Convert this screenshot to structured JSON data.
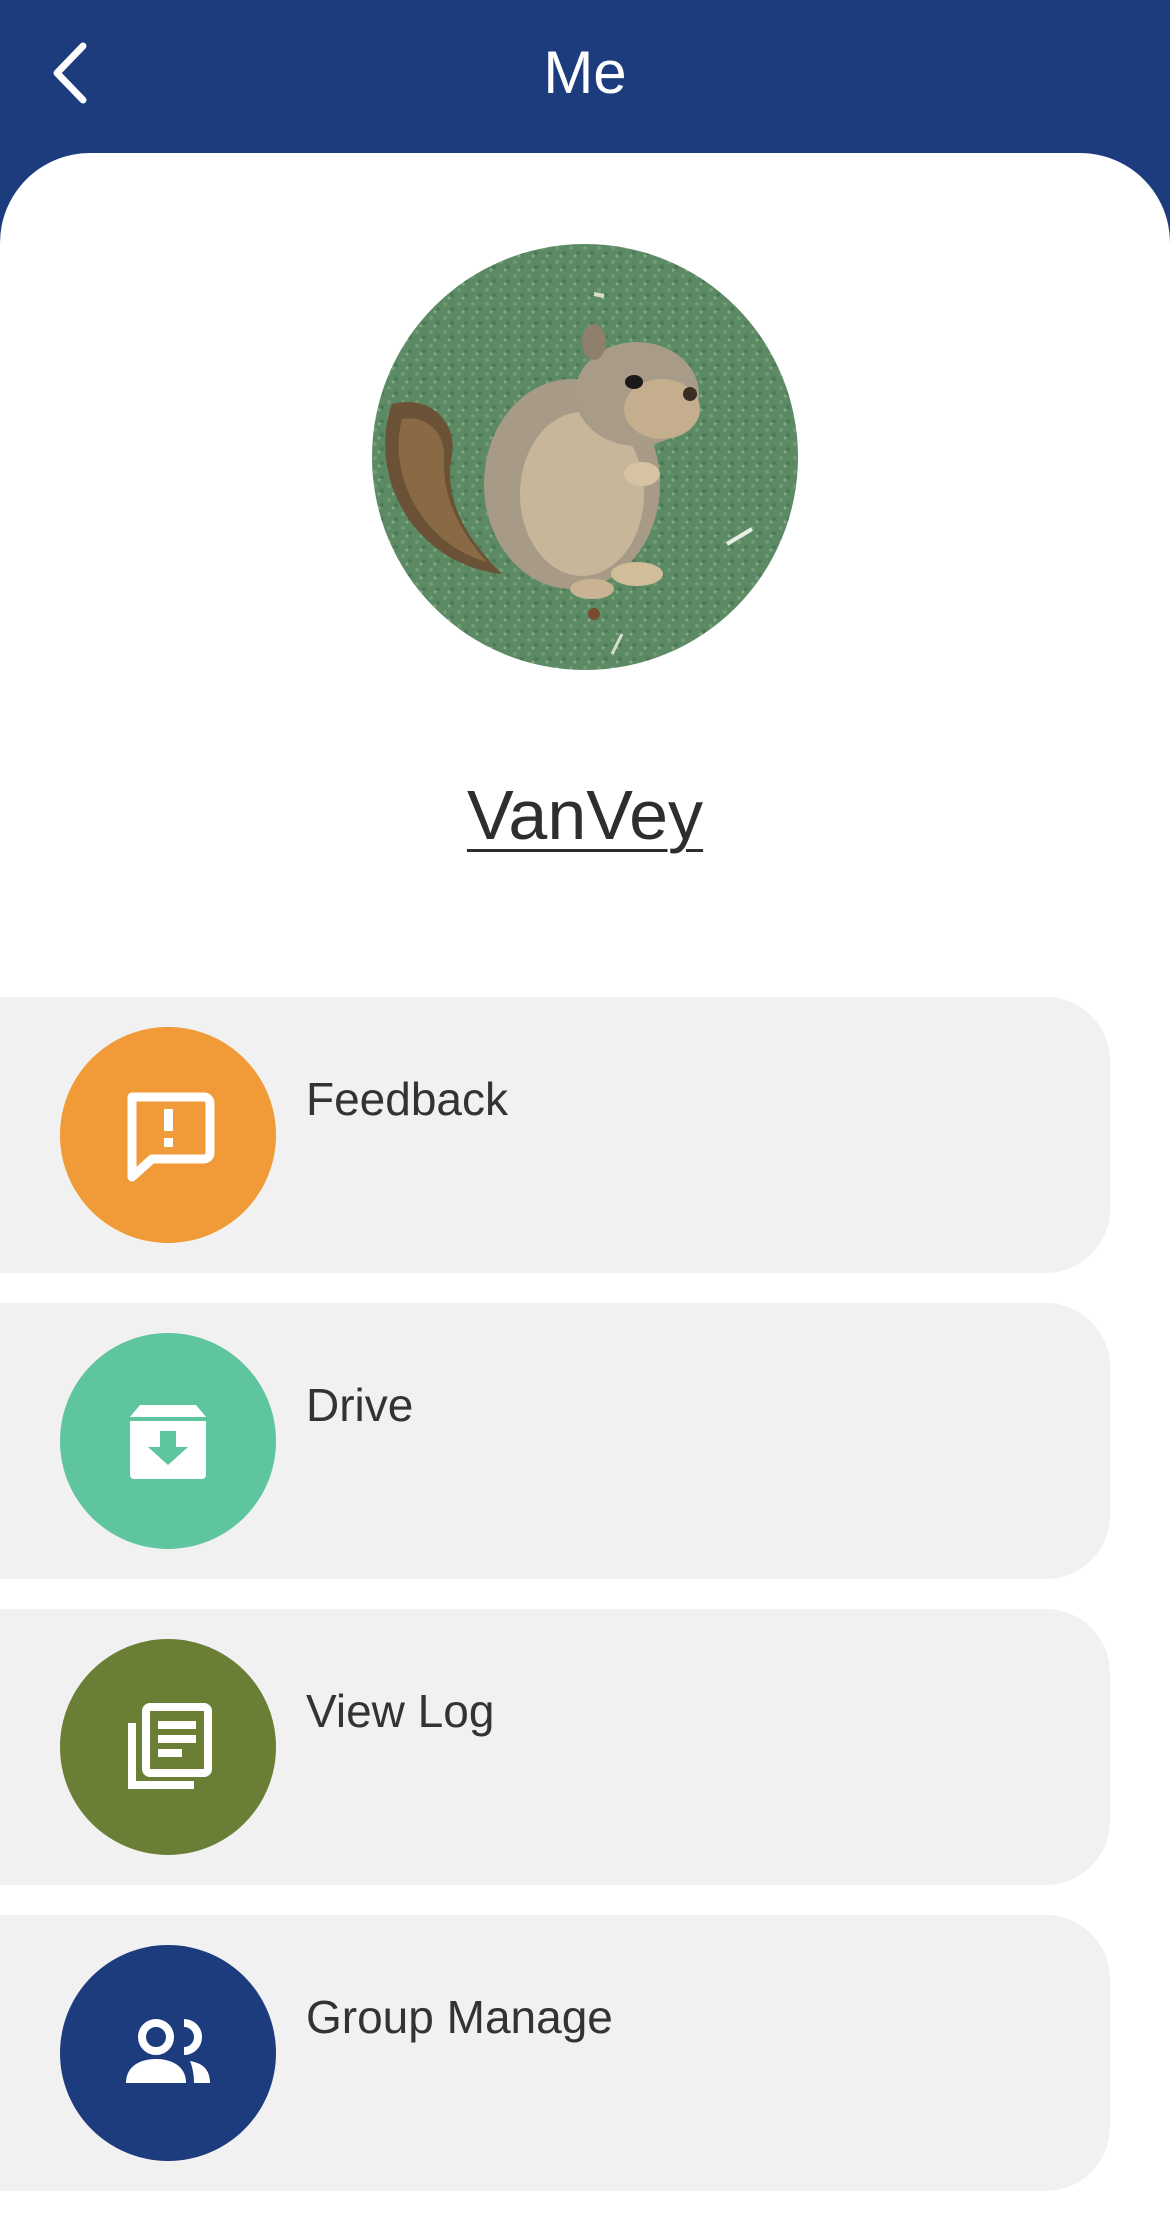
{
  "header": {
    "title": "Me",
    "background_color": "#1d3c7e",
    "back_icon": "chevron-left-icon"
  },
  "profile": {
    "avatar_description": "squirrel-photo",
    "username": "VanVey"
  },
  "menu": {
    "items": [
      {
        "label": "Feedback",
        "icon": "feedback-icon",
        "color": "#f09a38"
      },
      {
        "label": "Drive",
        "icon": "archive-icon",
        "color": "#5fc59e"
      },
      {
        "label": "View Log",
        "icon": "log-icon",
        "color": "#6a7f35"
      },
      {
        "label": "Group Manage",
        "icon": "group-icon",
        "color": "#1d3c7e"
      }
    ]
  }
}
